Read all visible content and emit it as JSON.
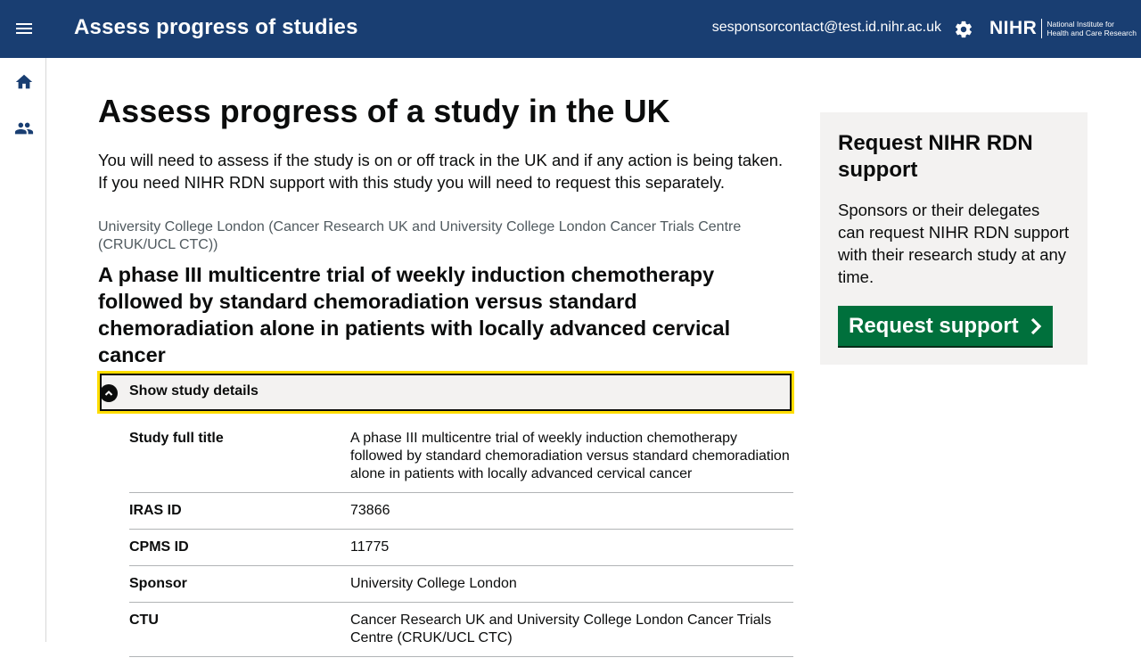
{
  "header": {
    "menu_icon": "hamburger-menu-icon",
    "app_title": "Assess progress of studies",
    "user_email": "sesponsorcontact@test.id.nihr.ac.uk",
    "settings_icon": "gear-icon",
    "logo": {
      "mark": "NIHR",
      "text_line1": "National Institute for",
      "text_line2": "Health and Care Research"
    },
    "background_color": "#193e72"
  },
  "sidenav": {
    "items": [
      {
        "icon": "home-icon"
      },
      {
        "icon": "people-icon"
      }
    ]
  },
  "main": {
    "page_title": "Assess progress of a study in the UK",
    "intro": "You will need to assess if the study is on or off track in the UK and if any action is being taken. If you need NIHR RDN support with this study you will need to request this separately.",
    "org_caption": "University College London (Cancer Research UK and University College London Cancer Trials Centre (CRUK/UCL CTC))",
    "study_heading": "A phase III multicentre trial of weekly induction chemotherapy followed by standard chemoradiation versus standard chemoradiation alone in patients with locally advanced cervical cancer",
    "details_toggle_label": "Show study details",
    "summary": [
      {
        "key": "Study full title",
        "value": "A phase III multicentre trial of weekly induction chemotherapy followed by standard chemoradiation versus standard chemoradiation alone in patients with locally advanced cervical cancer"
      },
      {
        "key": "IRAS ID",
        "value": "73866"
      },
      {
        "key": "CPMS ID",
        "value": "11775"
      },
      {
        "key": "Sponsor",
        "value": "University College London"
      },
      {
        "key": "CTU",
        "value": "Cancer Research UK and University College London Cancer Trials Centre (CRUK/UCL CTC)"
      }
    ]
  },
  "aside": {
    "title": "Request NIHR RDN support",
    "text": "Sponsors or their delegates can request NIHR RDN support with their research study at any time.",
    "button_label": "Request support",
    "button_color": "#00703c"
  },
  "colors": {
    "focus_yellow": "#ffdd00",
    "panel_grey": "#f3f2f1"
  }
}
